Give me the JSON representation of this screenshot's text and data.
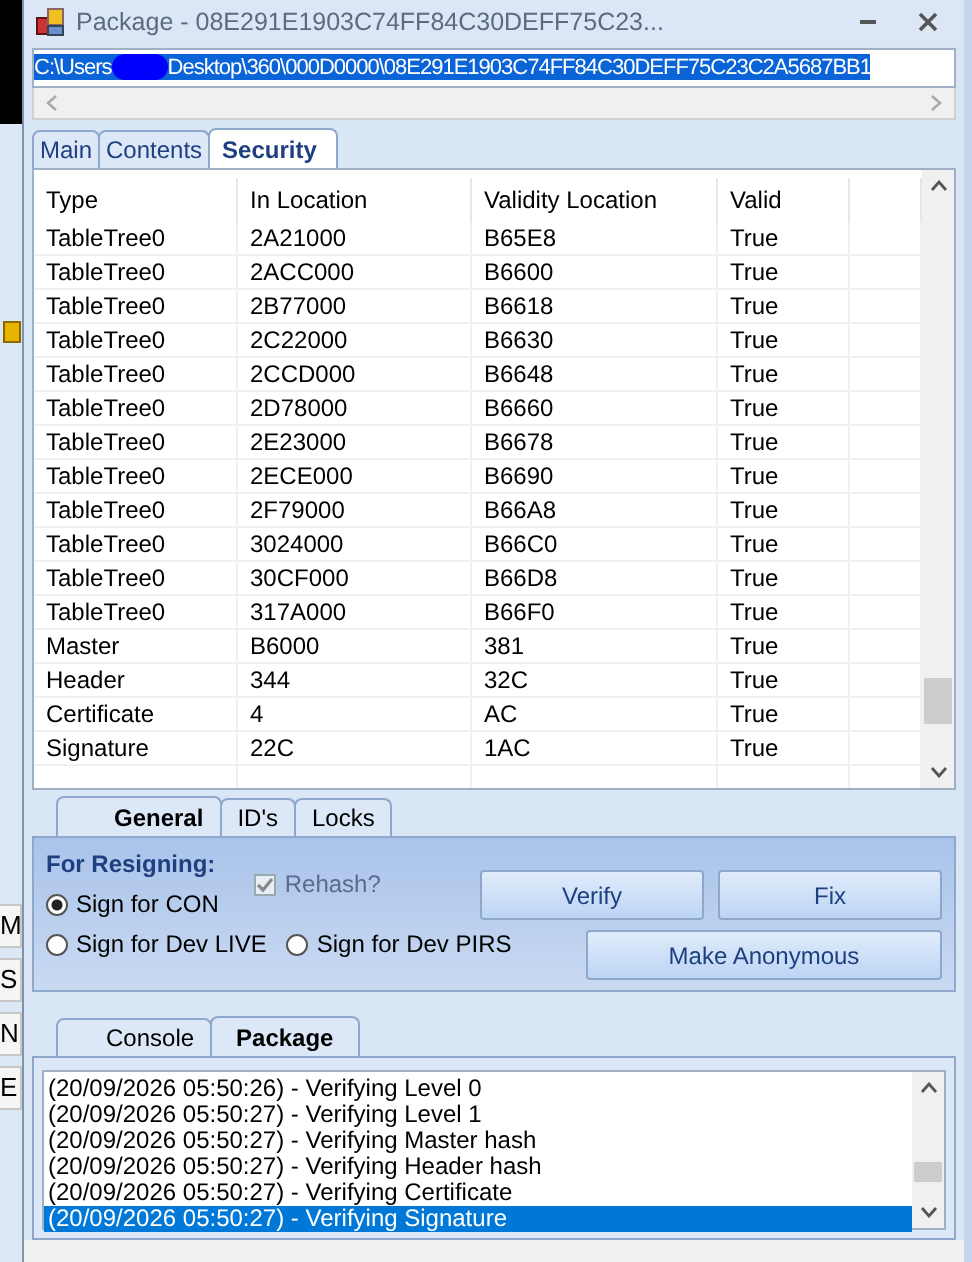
{
  "background_window": {
    "side_labels": [
      "M",
      "S",
      "N",
      "E"
    ]
  },
  "window": {
    "title": "Package - 08E291E1903C74FF84C30DEFF75C23..."
  },
  "path_field": {
    "value_start": "C:\\Users",
    "value_end": "Desktop\\360\\000D0000\\08E291E1903C74FF84C30DEFF75C23C2A5687BB1"
  },
  "tabs": [
    {
      "label": "Main",
      "selected": false
    },
    {
      "label": "Contents",
      "selected": false
    },
    {
      "label": "Security",
      "selected": true
    }
  ],
  "table": {
    "columns": [
      "Type",
      "In Location",
      "Validity Location",
      "Valid"
    ],
    "rows": [
      [
        "TableTree0",
        "2A21000",
        "B65E8",
        "True"
      ],
      [
        "TableTree0",
        "2ACC000",
        "B6600",
        "True"
      ],
      [
        "TableTree0",
        "2B77000",
        "B6618",
        "True"
      ],
      [
        "TableTree0",
        "2C22000",
        "B6630",
        "True"
      ],
      [
        "TableTree0",
        "2CCD000",
        "B6648",
        "True"
      ],
      [
        "TableTree0",
        "2D78000",
        "B6660",
        "True"
      ],
      [
        "TableTree0",
        "2E23000",
        "B6678",
        "True"
      ],
      [
        "TableTree0",
        "2ECE000",
        "B6690",
        "True"
      ],
      [
        "TableTree0",
        "2F79000",
        "B66A8",
        "True"
      ],
      [
        "TableTree0",
        "3024000",
        "B66C0",
        "True"
      ],
      [
        "TableTree0",
        "30CF000",
        "B66D8",
        "True"
      ],
      [
        "TableTree0",
        "317A000",
        "B66F0",
        "True"
      ],
      [
        "Master",
        "B6000",
        "381",
        "True"
      ],
      [
        "Header",
        "344",
        "32C",
        "True"
      ],
      [
        "Certificate",
        "4",
        "AC",
        "True"
      ],
      [
        "Signature",
        "22C",
        "1AC",
        "True"
      ]
    ]
  },
  "lower_tabs": [
    {
      "label": "General",
      "selected": true
    },
    {
      "label": "ID's",
      "selected": false
    },
    {
      "label": "Locks",
      "selected": false
    }
  ],
  "general": {
    "heading": "For Resigning:",
    "radios": [
      {
        "label": "Sign for CON",
        "selected": true
      },
      {
        "label": "Sign for Dev LIVE",
        "selected": false
      },
      {
        "label": "Sign for Dev PIRS",
        "selected": false
      }
    ],
    "rehash": {
      "label": "Rehash?",
      "checked": true,
      "disabled": true
    },
    "buttons": [
      "Verify",
      "Fix",
      "Make Anonymous"
    ]
  },
  "log_tabs": [
    {
      "label": "Console",
      "selected": false
    },
    {
      "label": "Package",
      "selected": true
    }
  ],
  "log": [
    {
      "text": "(20/09/2026 05:50:26) - Verifying Level 0",
      "selected": false
    },
    {
      "text": "(20/09/2026 05:50:27) - Verifying Level 1",
      "selected": false
    },
    {
      "text": "(20/09/2026 05:50:27) - Verifying Master hash",
      "selected": false
    },
    {
      "text": "(20/09/2026 05:50:27) - Verifying Header hash",
      "selected": false
    },
    {
      "text": "(20/09/2026 05:50:27) - Verifying Certificate",
      "selected": false
    },
    {
      "text": "(20/09/2026 05:50:27) - Verifying Signature",
      "selected": true
    }
  ]
}
